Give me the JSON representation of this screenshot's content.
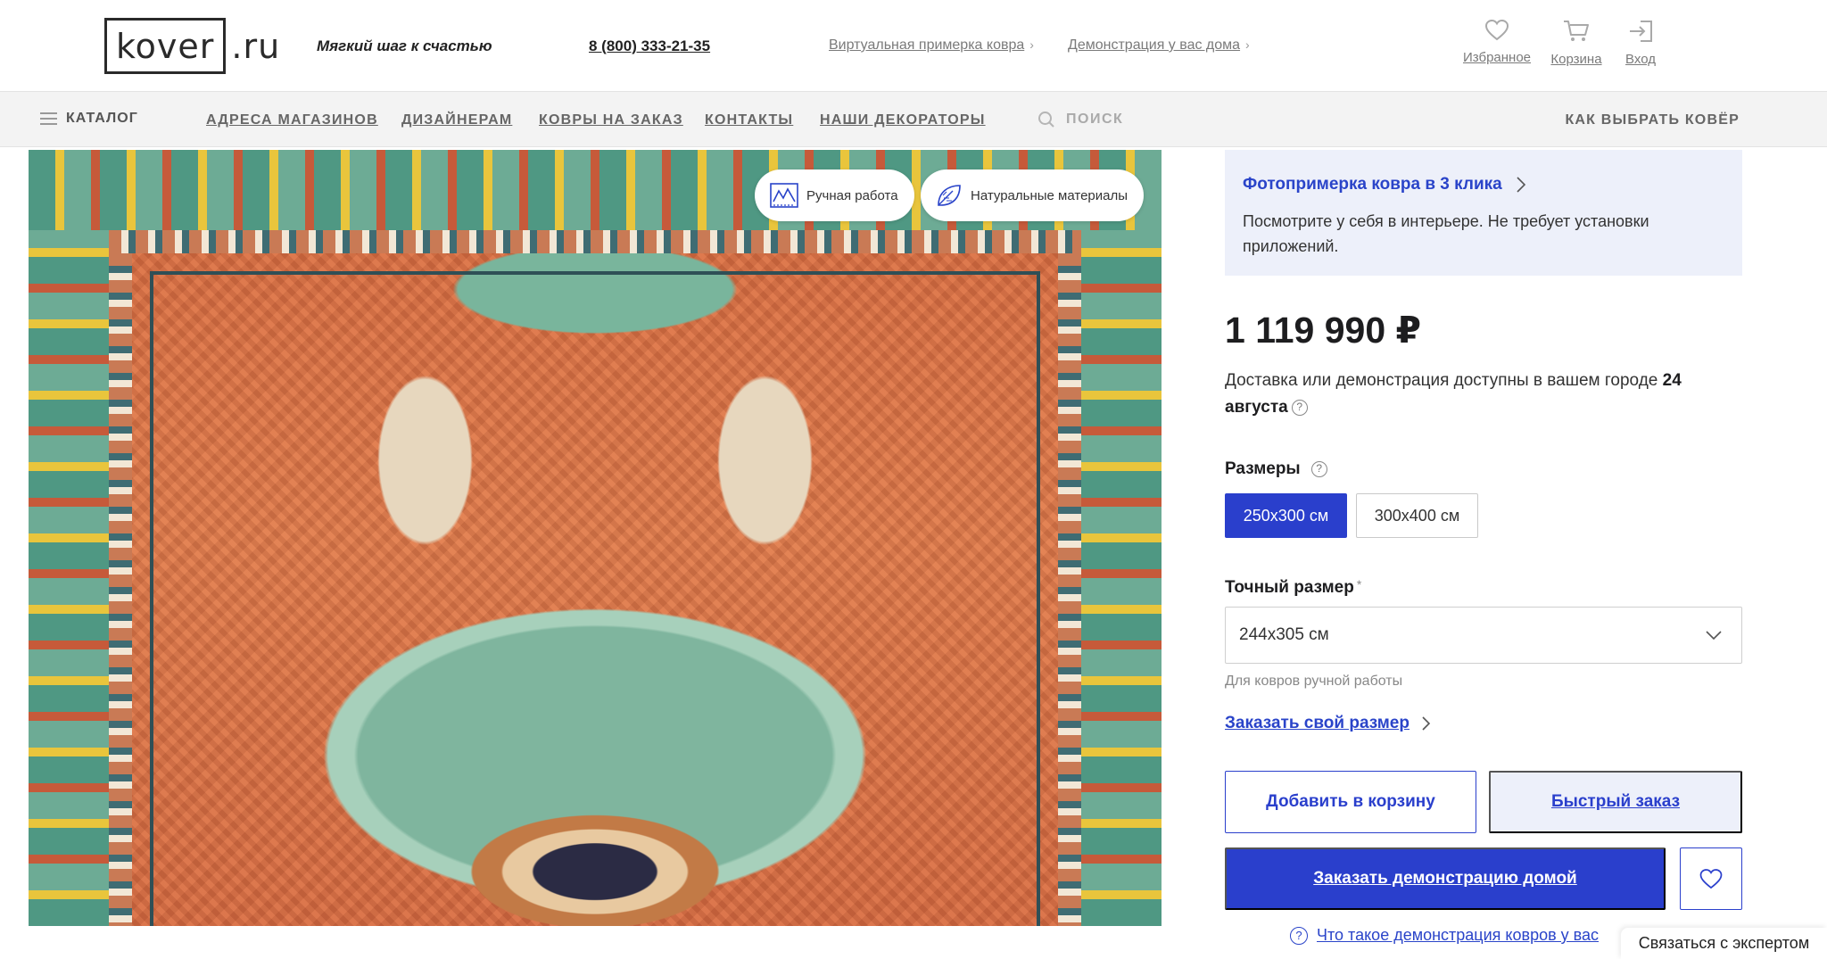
{
  "header": {
    "logo_main": "kover",
    "logo_suffix": ".ru",
    "slogan": "Мягкий шаг к счастью",
    "phone": "8 (800) 333-21-35",
    "link_virtual": "Виртуальная примерка ковра",
    "link_demo": "Демонстрация у вас дома",
    "favorites_label": "Избранное",
    "cart_label": "Корзина",
    "login_label": "Вход"
  },
  "nav": {
    "catalog": "КАТАЛОГ",
    "items": [
      "АДРЕСА МАГАЗИНОВ",
      "ДИЗАЙНЕРАМ",
      "КОВРЫ НА ЗАКАЗ",
      "КОНТАКТЫ",
      "НАШИ ДЕКОРАТОРЫ"
    ],
    "search_placeholder": "ПОИСК",
    "how_to_choose": "КАК ВЫБРАТЬ КОВЁР"
  },
  "image_badges": {
    "handmade": "Ручная работа",
    "natural": "Натуральные материалы"
  },
  "photo_fitting": {
    "title": "Фотопримерка ковра в 3 клика",
    "description": "Посмотрите у себя в интерьере. Не требует установки приложений."
  },
  "product": {
    "price": "1 119 990 ₽",
    "delivery_text": "Доставка или демонстрация доступны в вашем городе",
    "delivery_date": "24 августа",
    "sizes_label": "Размеры",
    "sizes": [
      "250x300 см",
      "300x400 см"
    ],
    "selected_size": "250x300 см",
    "exact_size_label": "Точный размер",
    "exact_size_required_mark": "*",
    "exact_size_value": "244x305 см",
    "exact_size_hint": "Для ковров ручной работы",
    "order_own_size": "Заказать свой размер"
  },
  "actions": {
    "add_to_cart": "Добавить в корзину",
    "quick_order": "Быстрый заказ",
    "order_demo": "Заказать демонстрацию  домой",
    "what_is_demo": "Что такое демонстрация ковров у вас"
  },
  "chat": {
    "expert_label": "Связаться с экспертом"
  },
  "colors": {
    "accent_blue": "#2a3fcc",
    "panel_blue": "#edf0fa",
    "nav_bg": "#f3f3f3"
  }
}
